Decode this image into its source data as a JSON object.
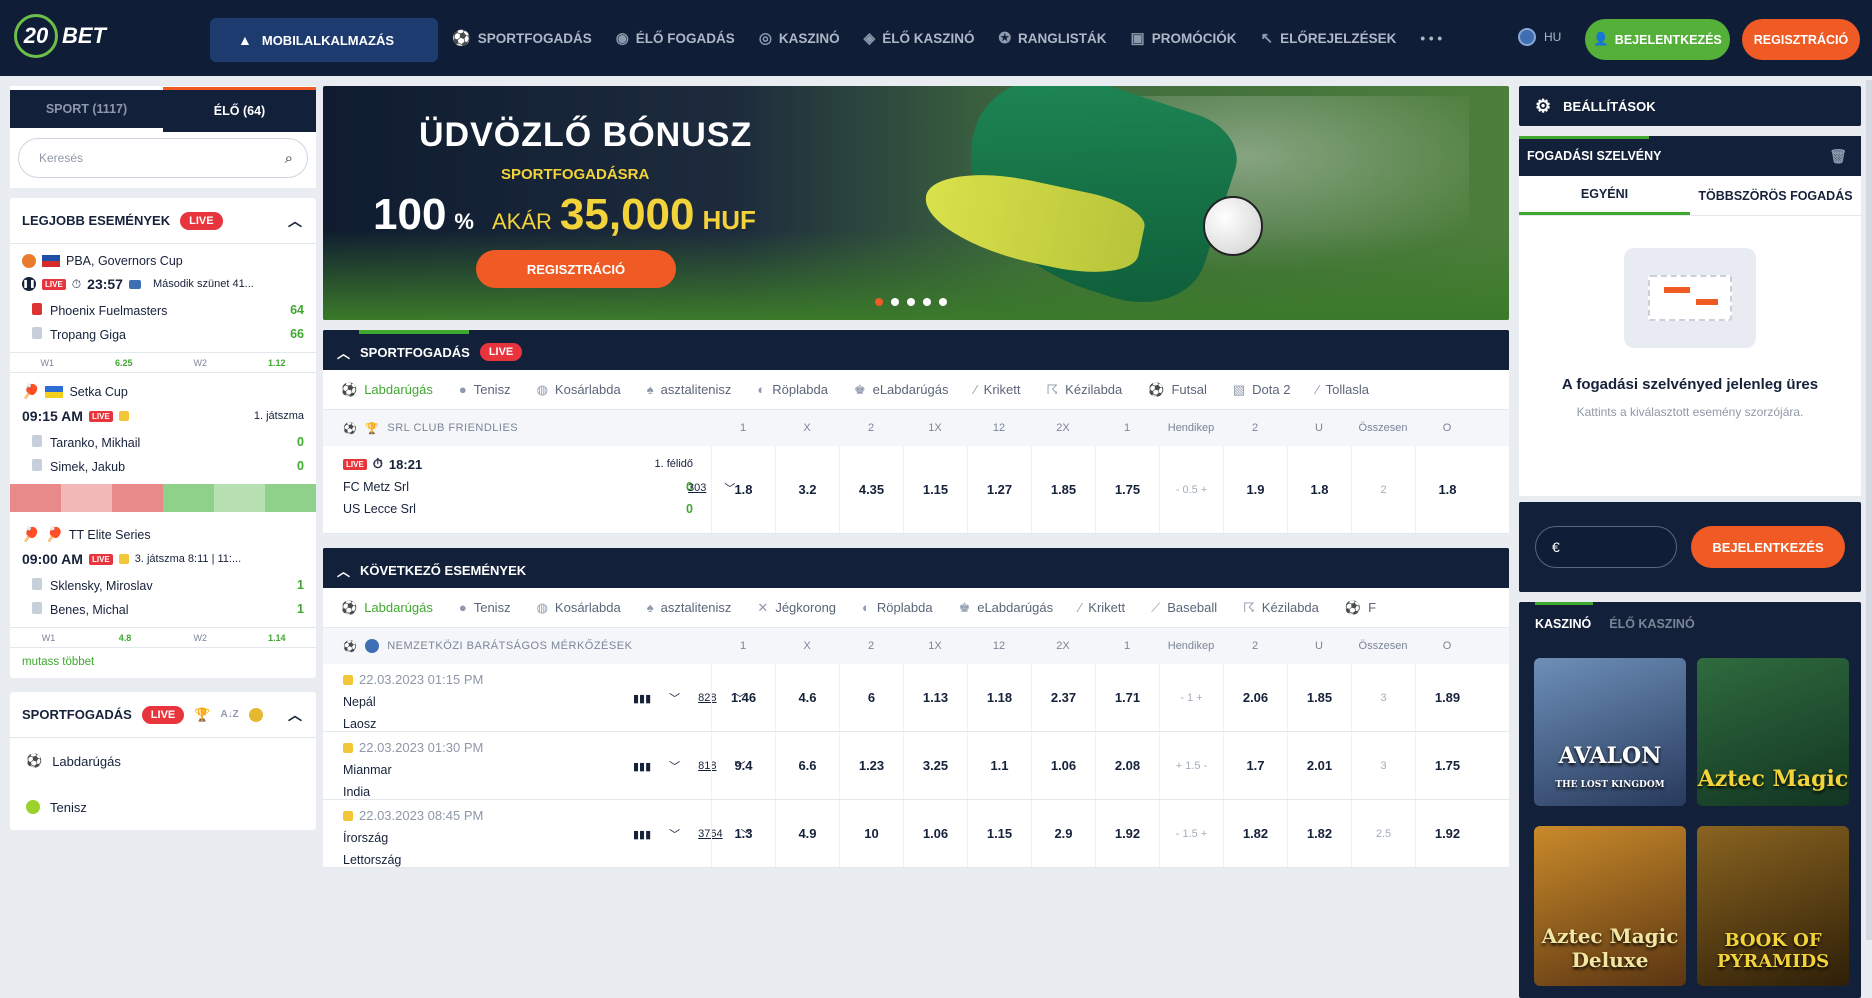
{
  "header": {
    "logo_num": "20",
    "logo_text": "BET",
    "mobile_app": "MOBILALKALMAZÁS",
    "nav": [
      {
        "icon": "⚽",
        "label": "SPORTFOGADÁS"
      },
      {
        "icon": "◉",
        "label": "ÉLŐ FOGADÁS"
      },
      {
        "icon": "◎",
        "label": "KASZINÓ"
      },
      {
        "icon": "◈",
        "label": "ÉLŐ KASZINÓ"
      },
      {
        "icon": "✪",
        "label": "RANGLISTÁK"
      },
      {
        "icon": "▣",
        "label": "PROMÓCIÓK"
      },
      {
        "icon": "↖",
        "label": "ELŐREJELZÉSEK"
      },
      {
        "icon": "",
        "label": "• • •"
      }
    ],
    "lang": "HU",
    "login": "BEJELENTKEZÉS",
    "register": "REGISZTRÁCIÓ"
  },
  "left": {
    "tab_sport": "SPORT (1117)",
    "tab_live": "ÉLŐ (64)",
    "search_placeholder": "Keresés",
    "best_events": "LEGJOBB ESEMÉNYEK",
    "live": "LIVE",
    "events": [
      {
        "league": "PBA, Governors Cup",
        "time": "23:57",
        "status": "Második szünet 41...",
        "team1": "Phoenix Fuelmasters",
        "score1": "64",
        "team2": "Tropang Giga",
        "score2": "66",
        "w1": "W1",
        "w1v": "6.25",
        "w2": "W2",
        "w2v": "1.12"
      },
      {
        "league": "Setka Cup",
        "time": "09:15 AM",
        "status": "1. játszma",
        "team1": "Taranko, Mikhail",
        "score1": "0",
        "team2": "Simek, Jakub",
        "score2": "0"
      },
      {
        "league": "TT Elite Series",
        "time": "09:00 AM",
        "status": "3. játszma 8:11 | 11:...",
        "team1": "Sklensky, Miroslav",
        "score1": "1",
        "team2": "Benes, Michal",
        "score2": "1",
        "w1": "W1",
        "w1v": "4.8",
        "w2": "W2",
        "w2v": "1.14"
      }
    ],
    "more": "mutass többet",
    "sportfogadas": "SPORTFOGADÁS",
    "sports": [
      "Labdarúgás",
      "Tenisz"
    ]
  },
  "banner": {
    "title": "ÜDVÖZLŐ BÓNUSZ",
    "subtitle": "SPORTFOGADÁSRA",
    "pct": "100",
    "pctsign": "%",
    "akar": "AKÁR",
    "amount": "35,000",
    "currency": "HUF",
    "button": "REGISZTRÁCIÓ"
  },
  "live_block": {
    "title": "SPORTFOGADÁS",
    "live": "LIVE",
    "tabs": [
      {
        "icon": "⚽",
        "label": "Labdarúgás"
      },
      {
        "icon": "●",
        "label": "Tenisz"
      },
      {
        "icon": "◍",
        "label": "Kosárlabda"
      },
      {
        "icon": "♠",
        "label": "asztalitenisz"
      },
      {
        "icon": "◐",
        "label": "Röplabda"
      },
      {
        "icon": "♚",
        "label": "eLabdarúgás"
      },
      {
        "icon": "⁄",
        "label": "Krikett"
      },
      {
        "icon": "☈",
        "label": "Kézilabda"
      },
      {
        "icon": "⚽",
        "label": "Futsal"
      },
      {
        "icon": "▧",
        "label": "Dota 2"
      },
      {
        "icon": "⁄",
        "label": "Tollasla"
      }
    ],
    "league": "SRL CLUB FRIENDLIES",
    "col_heads": [
      "1",
      "X",
      "2",
      "1X",
      "12",
      "2X",
      "1",
      "Hendikep",
      "2",
      "U",
      "Összesen",
      "O"
    ],
    "match": {
      "time": "18:21",
      "period": "1. félidő",
      "team1": "FC Metz Srl",
      "score1": "0",
      "team2": "US Lecce Srl",
      "score2": "0",
      "count": "303",
      "odds": [
        "1.8",
        "3.2",
        "4.35",
        "1.15",
        "1.27",
        "1.85",
        "1.75",
        "- 0.5 +",
        "1.9",
        "1.8",
        "2",
        "1.8"
      ]
    }
  },
  "next_block": {
    "title": "KÖVETKEZŐ ESEMÉNYEK",
    "tabs": [
      {
        "icon": "⚽",
        "label": "Labdarúgás"
      },
      {
        "icon": "●",
        "label": "Tenisz"
      },
      {
        "icon": "◍",
        "label": "Kosárlabda"
      },
      {
        "icon": "♠",
        "label": "asztalitenisz"
      },
      {
        "icon": "✕",
        "label": "Jégkorong"
      },
      {
        "icon": "◐",
        "label": "Röplabda"
      },
      {
        "icon": "♚",
        "label": "eLabdarúgás"
      },
      {
        "icon": "⁄",
        "label": "Krikett"
      },
      {
        "icon": "⟋",
        "label": "Baseball"
      },
      {
        "icon": "☈",
        "label": "Kézilabda"
      },
      {
        "icon": "⚽",
        "label": "F"
      }
    ],
    "league": "NEMZETKÖZI BARÁTSÁGOS MÉRKŐZÉSEK",
    "col_heads": [
      "1",
      "X",
      "2",
      "1X",
      "12",
      "2X",
      "1",
      "Hendikep",
      "2",
      "U",
      "Összesen",
      "O"
    ],
    "matches": [
      {
        "date": "22.03.2023 01:15 PM",
        "team1": "Nepál",
        "team2": "Laosz",
        "count": "828",
        "odds": [
          "1.46",
          "4.6",
          "6",
          "1.13",
          "1.18",
          "2.37",
          "1.71",
          "- 1 +",
          "2.06",
          "1.85",
          "3",
          "1.89"
        ]
      },
      {
        "date": "22.03.2023 01:30 PM",
        "team1": "Mianmar",
        "team2": "India",
        "count": "818",
        "odds": [
          "9.4",
          "6.6",
          "1.23",
          "3.25",
          "1.1",
          "1.06",
          "2.08",
          "+ 1.5 -",
          "1.7",
          "2.01",
          "3",
          "1.75"
        ]
      },
      {
        "date": "22.03.2023 08:45 PM",
        "team1": "Írország",
        "team2": "Lettország",
        "count": "3764",
        "odds": [
          "1.3",
          "4.9",
          "10",
          "1.06",
          "1.15",
          "2.9",
          "1.92",
          "- 1.5 +",
          "1.82",
          "1.82",
          "2.5",
          "1.92"
        ]
      }
    ]
  },
  "right": {
    "settings": "BEÁLLÍTÁSOK",
    "slip_title": "FOGADÁSI SZELVÉNY",
    "tab_single": "EGYÉNI",
    "tab_multi": "TÖBBSZÖRÖS FOGADÁS",
    "empty_title": "A fogadási szelvényed jelenleg üres",
    "empty_sub": "Kattints a kiválasztott esemény szorzójára.",
    "currency": "€",
    "login": "BEJELENTKEZÉS",
    "casino_tab": "KASZINÓ",
    "live_casino_tab": "ÉLŐ KASZINÓ",
    "games": [
      "AVALON",
      "Aztec Magic",
      "Aztec Magic Deluxe",
      "BOOK OF PYRAMIDS"
    ],
    "game_sub": [
      "THE LOST KINGDOM",
      "",
      "",
      ""
    ]
  }
}
